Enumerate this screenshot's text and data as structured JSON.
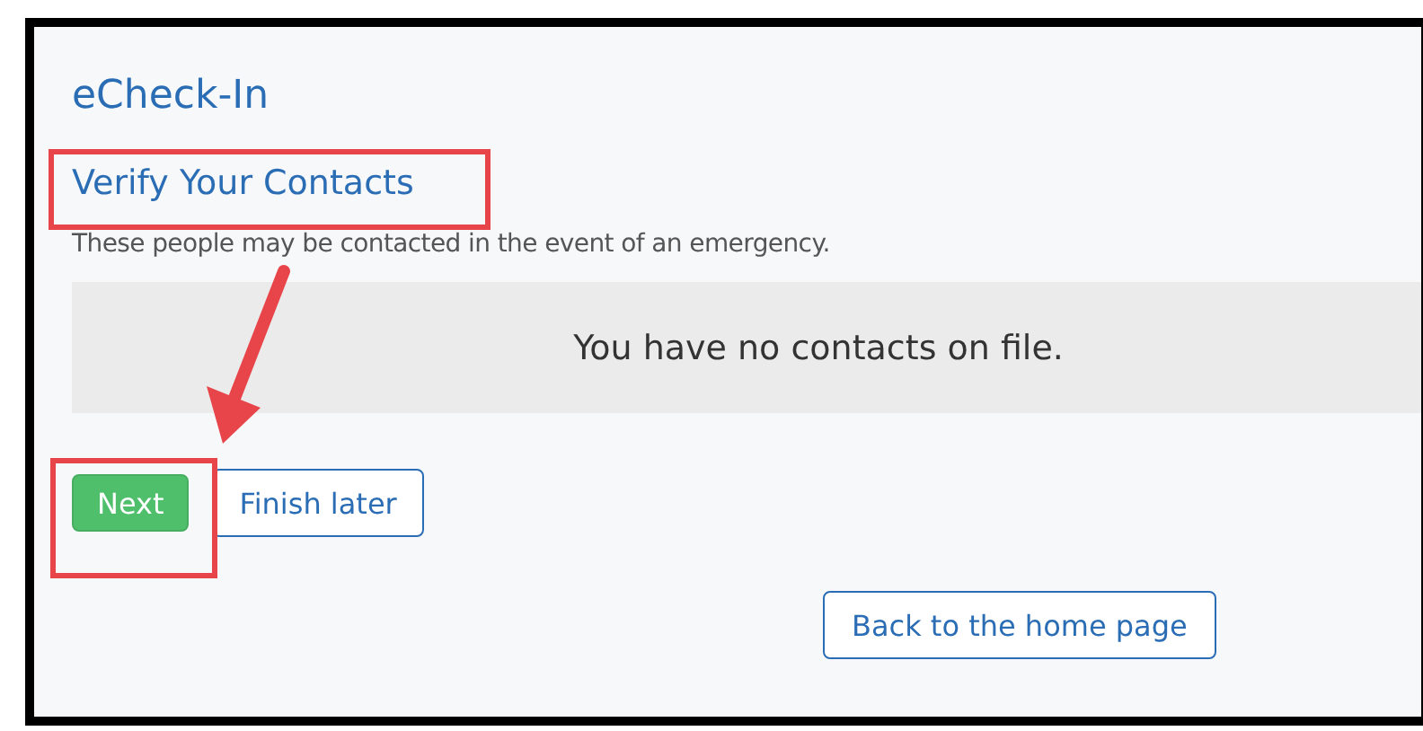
{
  "page": {
    "title": "eCheck-In"
  },
  "section": {
    "heading": "Verify Your Contacts",
    "description": "These people may be contacted in the event of an emergency."
  },
  "contacts_panel": {
    "message": "You have no contacts on file."
  },
  "buttons": [
    {
      "label": "Next",
      "kind": "primary"
    },
    {
      "label": "Finish later",
      "kind": "outline"
    }
  ],
  "home_button": {
    "label": "Back to the home page"
  }
}
